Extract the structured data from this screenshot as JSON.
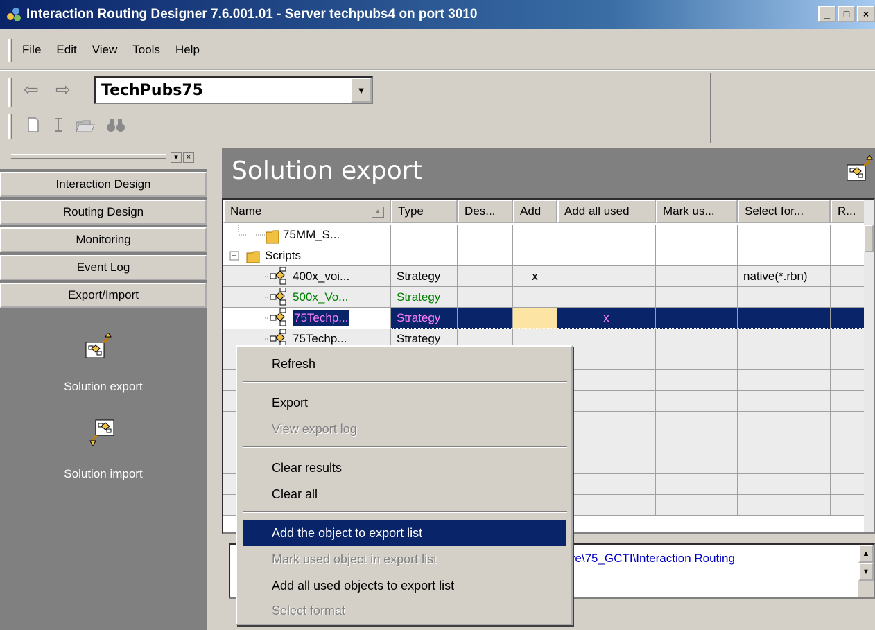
{
  "window": {
    "title": "Interaction Routing Designer  7.6.001.01  - Server techpubs4 on port 3010",
    "min_label": "_",
    "max_label": "□",
    "close_label": "×"
  },
  "menu": {
    "items": [
      "File",
      "Edit",
      "View",
      "Tools",
      "Help"
    ]
  },
  "toolbar": {
    "back_icon": "⇦",
    "forward_icon": "⇨",
    "server_combo_value": "TechPubs75",
    "combo_arrow": "▼"
  },
  "left_panel": {
    "tabs": [
      "Interaction Design",
      "Routing Design",
      "Monitoring",
      "Event Log",
      "Export/Import"
    ],
    "export_label": "Solution export",
    "import_label": "Solution import",
    "mini_buttons": [
      "▾",
      "×"
    ]
  },
  "main": {
    "title": "Solution export",
    "columns": [
      "Name",
      "Type",
      "Des...",
      "Add",
      "Add all used",
      "Mark us...",
      "Select for...",
      "R..."
    ],
    "sort_indicator": "▲",
    "rows": [
      {
        "name": "75MM_S...",
        "type": "",
        "add": "",
        "add_all": "",
        "select": "",
        "icon": "folder"
      },
      {
        "name": "Scripts",
        "type": "",
        "add": "",
        "add_all": "",
        "select": "",
        "icon": "folder"
      },
      {
        "name": "400x_voi...",
        "type": "Strategy",
        "add": "x",
        "add_all": "",
        "select": "native(*.rbn)",
        "icon": "strategy"
      },
      {
        "name": "500x_Vo...",
        "type": "Strategy",
        "add": "",
        "add_all": "",
        "select": "",
        "icon": "strategy"
      },
      {
        "name": "75Techp...",
        "type": "Strategy",
        "add": "",
        "add_all": "x",
        "select": "",
        "icon": "strategy"
      },
      {
        "name": "75Techp...",
        "type": "Strategy",
        "add": "",
        "add_all": "",
        "select": "",
        "icon": "strategy"
      }
    ],
    "info_path": "ware\\75_GCTI\\Interaction Routing"
  },
  "context_menu": {
    "items": [
      {
        "label": "Refresh",
        "disabled": false
      },
      {
        "label": "Export",
        "disabled": false
      },
      {
        "label": "View export log",
        "disabled": true
      },
      {
        "label": "Clear results",
        "disabled": false
      },
      {
        "label": "Clear all",
        "disabled": false
      },
      {
        "label": "Add the object to export list",
        "disabled": false,
        "highlighted": true
      },
      {
        "label": "Mark used object in export list",
        "disabled": true
      },
      {
        "label": "Add all used objects to export list",
        "disabled": false
      },
      {
        "label": "Select format",
        "disabled": true
      }
    ]
  },
  "colors": {
    "title_bar": "#0a246a",
    "selection": "#0a246a",
    "panel_gray": "#808080",
    "face": "#d4d0c8"
  }
}
